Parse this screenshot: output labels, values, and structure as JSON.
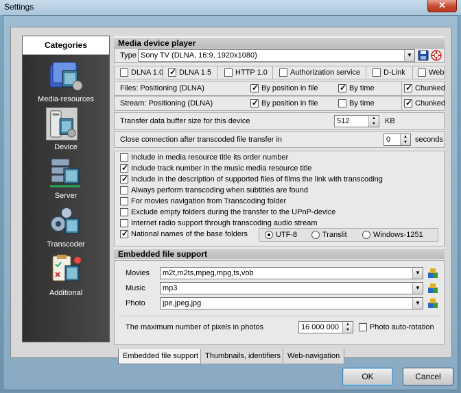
{
  "window": {
    "title": "Settings",
    "close_label": "✕"
  },
  "categories": {
    "title": "Categories",
    "items": [
      {
        "label": "Media-resources",
        "icon": "media-resources-icon"
      },
      {
        "label": "Device",
        "icon": "device-icon"
      },
      {
        "label": "Server",
        "icon": "server-icon"
      },
      {
        "label": "Transcoder",
        "icon": "transcoder-icon"
      },
      {
        "label": "Additional",
        "icon": "additional-icon"
      }
    ],
    "selected": "Device"
  },
  "media_device_player": {
    "title": "Media device player",
    "type_label": "Type",
    "type_value": "Sony TV (DLNA, 16:9, 1920x1080)",
    "protocols": [
      {
        "label": "DLNA 1.0",
        "checked": false
      },
      {
        "label": "DLNA 1.5",
        "checked": true
      },
      {
        "label": "HTTP 1.0",
        "checked": false
      },
      {
        "label": "Authorization service",
        "checked": false
      },
      {
        "label": "D-Link",
        "checked": false
      },
      {
        "label": "Web",
        "checked": false
      }
    ],
    "files_row": {
      "label": "Files: Positioning (DLNA)",
      "by_position": {
        "label": "By position in file",
        "checked": true
      },
      "by_time": {
        "label": "By time",
        "checked": true
      },
      "chunked": {
        "label": "Chunked",
        "checked": true
      }
    },
    "stream_row": {
      "label": "Stream: Positioning (DLNA)",
      "by_position": {
        "label": "By position in file",
        "checked": true
      },
      "by_time": {
        "label": "By time",
        "checked": false
      },
      "chunked": {
        "label": "Chunked",
        "checked": true
      }
    },
    "buffer": {
      "label": "Transfer data buffer size for this device",
      "value": "512",
      "unit": "KB"
    },
    "close_after": {
      "label": "Close connection after transcoded file transfer in",
      "value": "0",
      "unit": "seconds"
    }
  },
  "options": [
    {
      "label": "Include in media resource title its order number",
      "checked": false
    },
    {
      "label": "Include track number in the music media resource title",
      "checked": true
    },
    {
      "label": "Include in the description of supported files of films the link with transcoding",
      "checked": true
    },
    {
      "label": "Always perform transcoding when subtitles are found",
      "checked": false
    },
    {
      "label": "For movies navigation from Transcoding folder",
      "checked": false
    },
    {
      "label": "Exclude empty folders during the transfer to the UPnP-device",
      "checked": false
    },
    {
      "label": "Internet radio support through transcoding audio stream",
      "checked": false
    },
    {
      "label": "National names of the base folders",
      "checked": true
    }
  ],
  "encoding": {
    "options": [
      {
        "label": "UTF-8",
        "selected": true
      },
      {
        "label": "Translit",
        "selected": false
      },
      {
        "label": "Windows-1251",
        "selected": false
      }
    ]
  },
  "embedded": {
    "title": "Embedded file support",
    "movies": {
      "label": "Movies",
      "value": "m2t,m2ts,mpeg,mpg,ts,vob"
    },
    "music": {
      "label": "Music",
      "value": "mp3"
    },
    "photo": {
      "label": "Photo",
      "value": "jpe,jpeg,jpg"
    },
    "max_pixels": {
      "label": "The maximum number of pixels in photos",
      "value": "16 000 000"
    },
    "auto_rotation": {
      "label": "Photo auto-rotation",
      "checked": false
    }
  },
  "tabs": [
    {
      "label": "Embedded file support",
      "active": true
    },
    {
      "label": "Thumbnails, identifiers",
      "active": false
    },
    {
      "label": "Web-navigation",
      "active": false
    }
  ],
  "footer": {
    "ok_label": "OK",
    "cancel_label": "Cancel"
  },
  "colors": {
    "accent_frame": "#8aaac3",
    "close_button": "#c7492f",
    "category_panel": "#3a3a3a"
  }
}
